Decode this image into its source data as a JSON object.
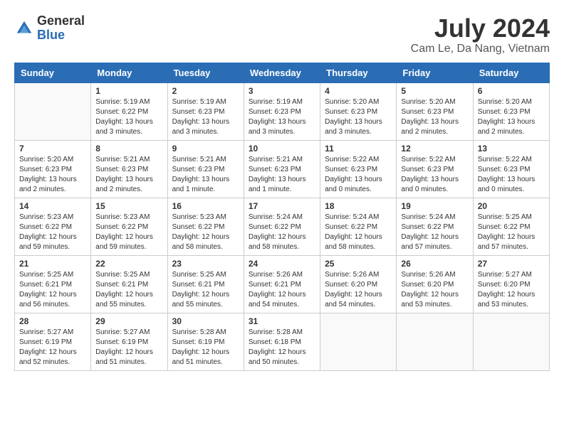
{
  "header": {
    "logo_general": "General",
    "logo_blue": "Blue",
    "title": "July 2024",
    "subtitle": "Cam Le, Da Nang, Vietnam"
  },
  "calendar": {
    "weekdays": [
      "Sunday",
      "Monday",
      "Tuesday",
      "Wednesday",
      "Thursday",
      "Friday",
      "Saturday"
    ],
    "weeks": [
      [
        {
          "day": "",
          "info": ""
        },
        {
          "day": "1",
          "info": "Sunrise: 5:19 AM\nSunset: 6:22 PM\nDaylight: 13 hours\nand 3 minutes."
        },
        {
          "day": "2",
          "info": "Sunrise: 5:19 AM\nSunset: 6:23 PM\nDaylight: 13 hours\nand 3 minutes."
        },
        {
          "day": "3",
          "info": "Sunrise: 5:19 AM\nSunset: 6:23 PM\nDaylight: 13 hours\nand 3 minutes."
        },
        {
          "day": "4",
          "info": "Sunrise: 5:20 AM\nSunset: 6:23 PM\nDaylight: 13 hours\nand 3 minutes."
        },
        {
          "day": "5",
          "info": "Sunrise: 5:20 AM\nSunset: 6:23 PM\nDaylight: 13 hours\nand 2 minutes."
        },
        {
          "day": "6",
          "info": "Sunrise: 5:20 AM\nSunset: 6:23 PM\nDaylight: 13 hours\nand 2 minutes."
        }
      ],
      [
        {
          "day": "7",
          "info": "Sunrise: 5:20 AM\nSunset: 6:23 PM\nDaylight: 13 hours\nand 2 minutes."
        },
        {
          "day": "8",
          "info": "Sunrise: 5:21 AM\nSunset: 6:23 PM\nDaylight: 13 hours\nand 2 minutes."
        },
        {
          "day": "9",
          "info": "Sunrise: 5:21 AM\nSunset: 6:23 PM\nDaylight: 13 hours\nand 1 minute."
        },
        {
          "day": "10",
          "info": "Sunrise: 5:21 AM\nSunset: 6:23 PM\nDaylight: 13 hours\nand 1 minute."
        },
        {
          "day": "11",
          "info": "Sunrise: 5:22 AM\nSunset: 6:23 PM\nDaylight: 13 hours\nand 0 minutes."
        },
        {
          "day": "12",
          "info": "Sunrise: 5:22 AM\nSunset: 6:23 PM\nDaylight: 13 hours\nand 0 minutes."
        },
        {
          "day": "13",
          "info": "Sunrise: 5:22 AM\nSunset: 6:23 PM\nDaylight: 13 hours\nand 0 minutes."
        }
      ],
      [
        {
          "day": "14",
          "info": "Sunrise: 5:23 AM\nSunset: 6:22 PM\nDaylight: 12 hours\nand 59 minutes."
        },
        {
          "day": "15",
          "info": "Sunrise: 5:23 AM\nSunset: 6:22 PM\nDaylight: 12 hours\nand 59 minutes."
        },
        {
          "day": "16",
          "info": "Sunrise: 5:23 AM\nSunset: 6:22 PM\nDaylight: 12 hours\nand 58 minutes."
        },
        {
          "day": "17",
          "info": "Sunrise: 5:24 AM\nSunset: 6:22 PM\nDaylight: 12 hours\nand 58 minutes."
        },
        {
          "day": "18",
          "info": "Sunrise: 5:24 AM\nSunset: 6:22 PM\nDaylight: 12 hours\nand 58 minutes."
        },
        {
          "day": "19",
          "info": "Sunrise: 5:24 AM\nSunset: 6:22 PM\nDaylight: 12 hours\nand 57 minutes."
        },
        {
          "day": "20",
          "info": "Sunrise: 5:25 AM\nSunset: 6:22 PM\nDaylight: 12 hours\nand 57 minutes."
        }
      ],
      [
        {
          "day": "21",
          "info": "Sunrise: 5:25 AM\nSunset: 6:21 PM\nDaylight: 12 hours\nand 56 minutes."
        },
        {
          "day": "22",
          "info": "Sunrise: 5:25 AM\nSunset: 6:21 PM\nDaylight: 12 hours\nand 55 minutes."
        },
        {
          "day": "23",
          "info": "Sunrise: 5:25 AM\nSunset: 6:21 PM\nDaylight: 12 hours\nand 55 minutes."
        },
        {
          "day": "24",
          "info": "Sunrise: 5:26 AM\nSunset: 6:21 PM\nDaylight: 12 hours\nand 54 minutes."
        },
        {
          "day": "25",
          "info": "Sunrise: 5:26 AM\nSunset: 6:20 PM\nDaylight: 12 hours\nand 54 minutes."
        },
        {
          "day": "26",
          "info": "Sunrise: 5:26 AM\nSunset: 6:20 PM\nDaylight: 12 hours\nand 53 minutes."
        },
        {
          "day": "27",
          "info": "Sunrise: 5:27 AM\nSunset: 6:20 PM\nDaylight: 12 hours\nand 53 minutes."
        }
      ],
      [
        {
          "day": "28",
          "info": "Sunrise: 5:27 AM\nSunset: 6:19 PM\nDaylight: 12 hours\nand 52 minutes."
        },
        {
          "day": "29",
          "info": "Sunrise: 5:27 AM\nSunset: 6:19 PM\nDaylight: 12 hours\nand 51 minutes."
        },
        {
          "day": "30",
          "info": "Sunrise: 5:28 AM\nSunset: 6:19 PM\nDaylight: 12 hours\nand 51 minutes."
        },
        {
          "day": "31",
          "info": "Sunrise: 5:28 AM\nSunset: 6:18 PM\nDaylight: 12 hours\nand 50 minutes."
        },
        {
          "day": "",
          "info": ""
        },
        {
          "day": "",
          "info": ""
        },
        {
          "day": "",
          "info": ""
        }
      ]
    ]
  }
}
